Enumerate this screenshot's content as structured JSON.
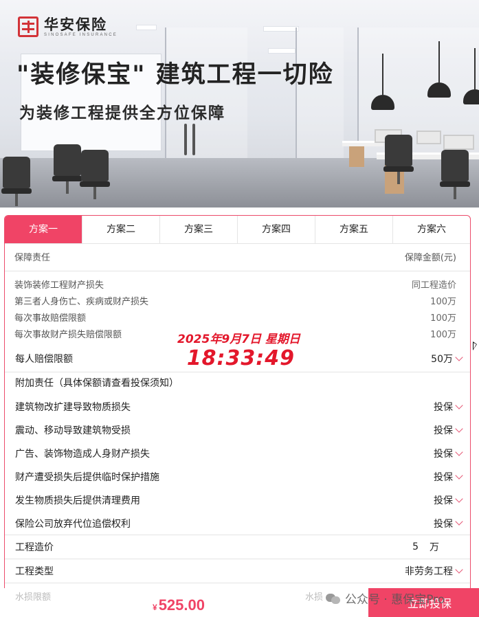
{
  "banner": {
    "logo_cn": "华安保险",
    "logo_en": "SINOSAFE INSURANCE",
    "headline": "\"装修保宝\" 建筑工程一切险",
    "subline": "为装修工程提供全方位保障"
  },
  "tabs": [
    {
      "label": "方案一",
      "active": true
    },
    {
      "label": "方案二",
      "active": false
    },
    {
      "label": "方案三",
      "active": false
    },
    {
      "label": "方案四",
      "active": false
    },
    {
      "label": "方案五",
      "active": false
    },
    {
      "label": "方案六",
      "active": false
    }
  ],
  "table_head": {
    "left": "保障责任",
    "right": "保障金额(元)"
  },
  "coverage": [
    {
      "label": "装饰装修工程财产损失",
      "value": "同工程造价"
    },
    {
      "label": "第三者人身伤亡、疾病或财产损失",
      "value": "100万"
    },
    {
      "label": "每次事故赔偿限额",
      "value": "100万"
    },
    {
      "label": "每次事故财产损失赔偿限额",
      "value": "100万"
    }
  ],
  "per_person": {
    "label": "每人赔偿限额",
    "value": "50万"
  },
  "addon_title": "附加责任（具体保额请查看投保须知）",
  "addons": [
    {
      "label": "建筑物改扩建导致物质损失",
      "value": "投保"
    },
    {
      "label": "震动、移动导致建筑物受损",
      "value": "投保"
    },
    {
      "label": "广告、装饰物造成人身财产损失",
      "value": "投保"
    },
    {
      "label": "财产遭受损失后提供临时保护措施",
      "value": "投保"
    },
    {
      "label": "发生物质损失后提供清理费用",
      "value": "投保"
    },
    {
      "label": "保险公司放弃代位追偿权利",
      "value": "投保"
    }
  ],
  "project_cost": {
    "label": "工程造价",
    "value": "5",
    "unit": "万"
  },
  "project_type": {
    "label": "工程类型",
    "value": "非劳务工程"
  },
  "faded": {
    "left": "水损限额",
    "right": "水损"
  },
  "clock": {
    "date": "2025年9月7日 星期日",
    "time": "18:33:49"
  },
  "footer": {
    "currency": "¥",
    "price": "525.00",
    "buy_label": "立即投保"
  },
  "watermark": "公众号 · 惠保宝Pro",
  "colors": {
    "accent": "#f04466",
    "clock": "#e3172b",
    "logo": "#d23338"
  }
}
